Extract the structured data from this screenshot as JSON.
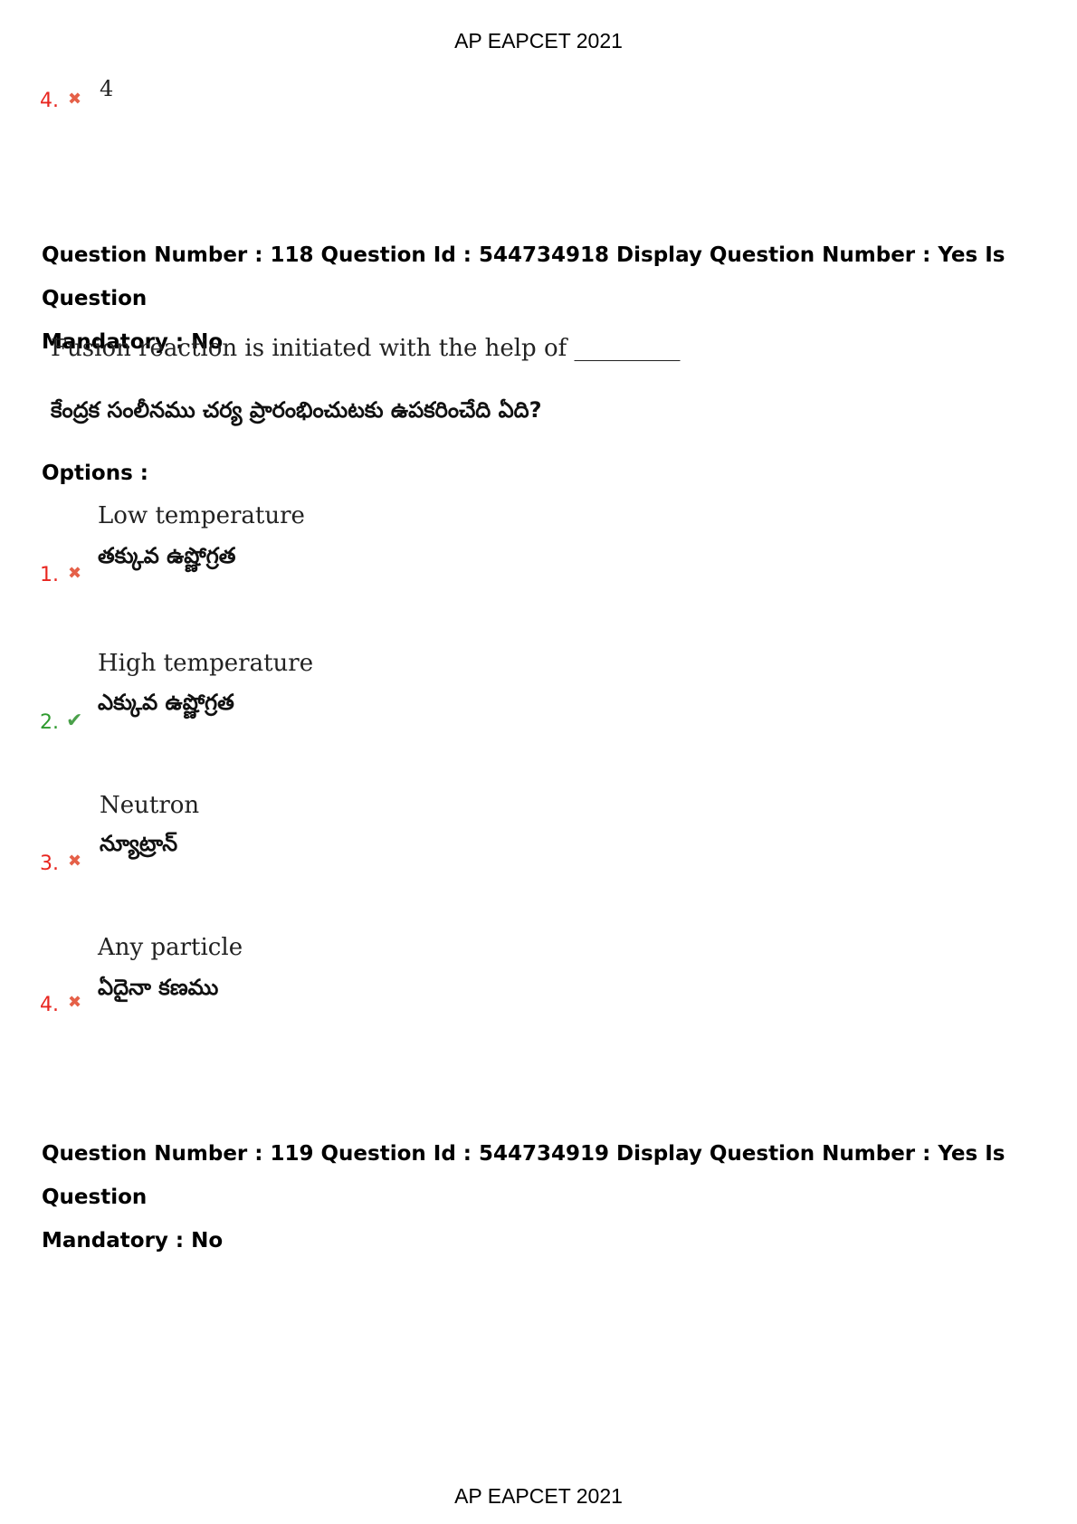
{
  "header": {
    "title": "AP EAPCET 2021"
  },
  "footer": {
    "title": "AP EAPCET 2021"
  },
  "prev_option": {
    "number": "4.",
    "status": "wrong",
    "value": "4"
  },
  "question_118": {
    "line1": "Question Number : 118 Question Id : 544734918 Display Question Number : Yes Is Question",
    "line2": "Mandatory : No",
    "text_en": "Fusion reaction is initiated with the help of _________",
    "text_te": "కేంద్రక సంలీనము చర్య ప్రారంభించుటకు ఉపకరించేది ఏది?",
    "options_label": "Options :",
    "options": [
      {
        "number": "1.",
        "status": "wrong",
        "en": "Low temperature",
        "te": "తక్కువ ఉష్ణోగ్రత"
      },
      {
        "number": "2.",
        "status": "right",
        "en": "High temperature",
        "te": "ఎక్కువ ఉష్ణోగ్రత"
      },
      {
        "number": "3.",
        "status": "wrong",
        "en": "Neutron",
        "te": "న్యూట్రాన్"
      },
      {
        "number": "4.",
        "status": "wrong",
        "en": "Any particle",
        "te": "ఏదైనా కణము"
      }
    ]
  },
  "question_119": {
    "line1": "Question Number : 119 Question Id : 544734919 Display Question Number : Yes Is Question",
    "line2": "Mandatory : No"
  },
  "icons": {
    "wrong": "cross-icon",
    "right": "check-icon"
  },
  "colors": {
    "wrong": "#e8251f",
    "right": "#2e9a2e"
  }
}
